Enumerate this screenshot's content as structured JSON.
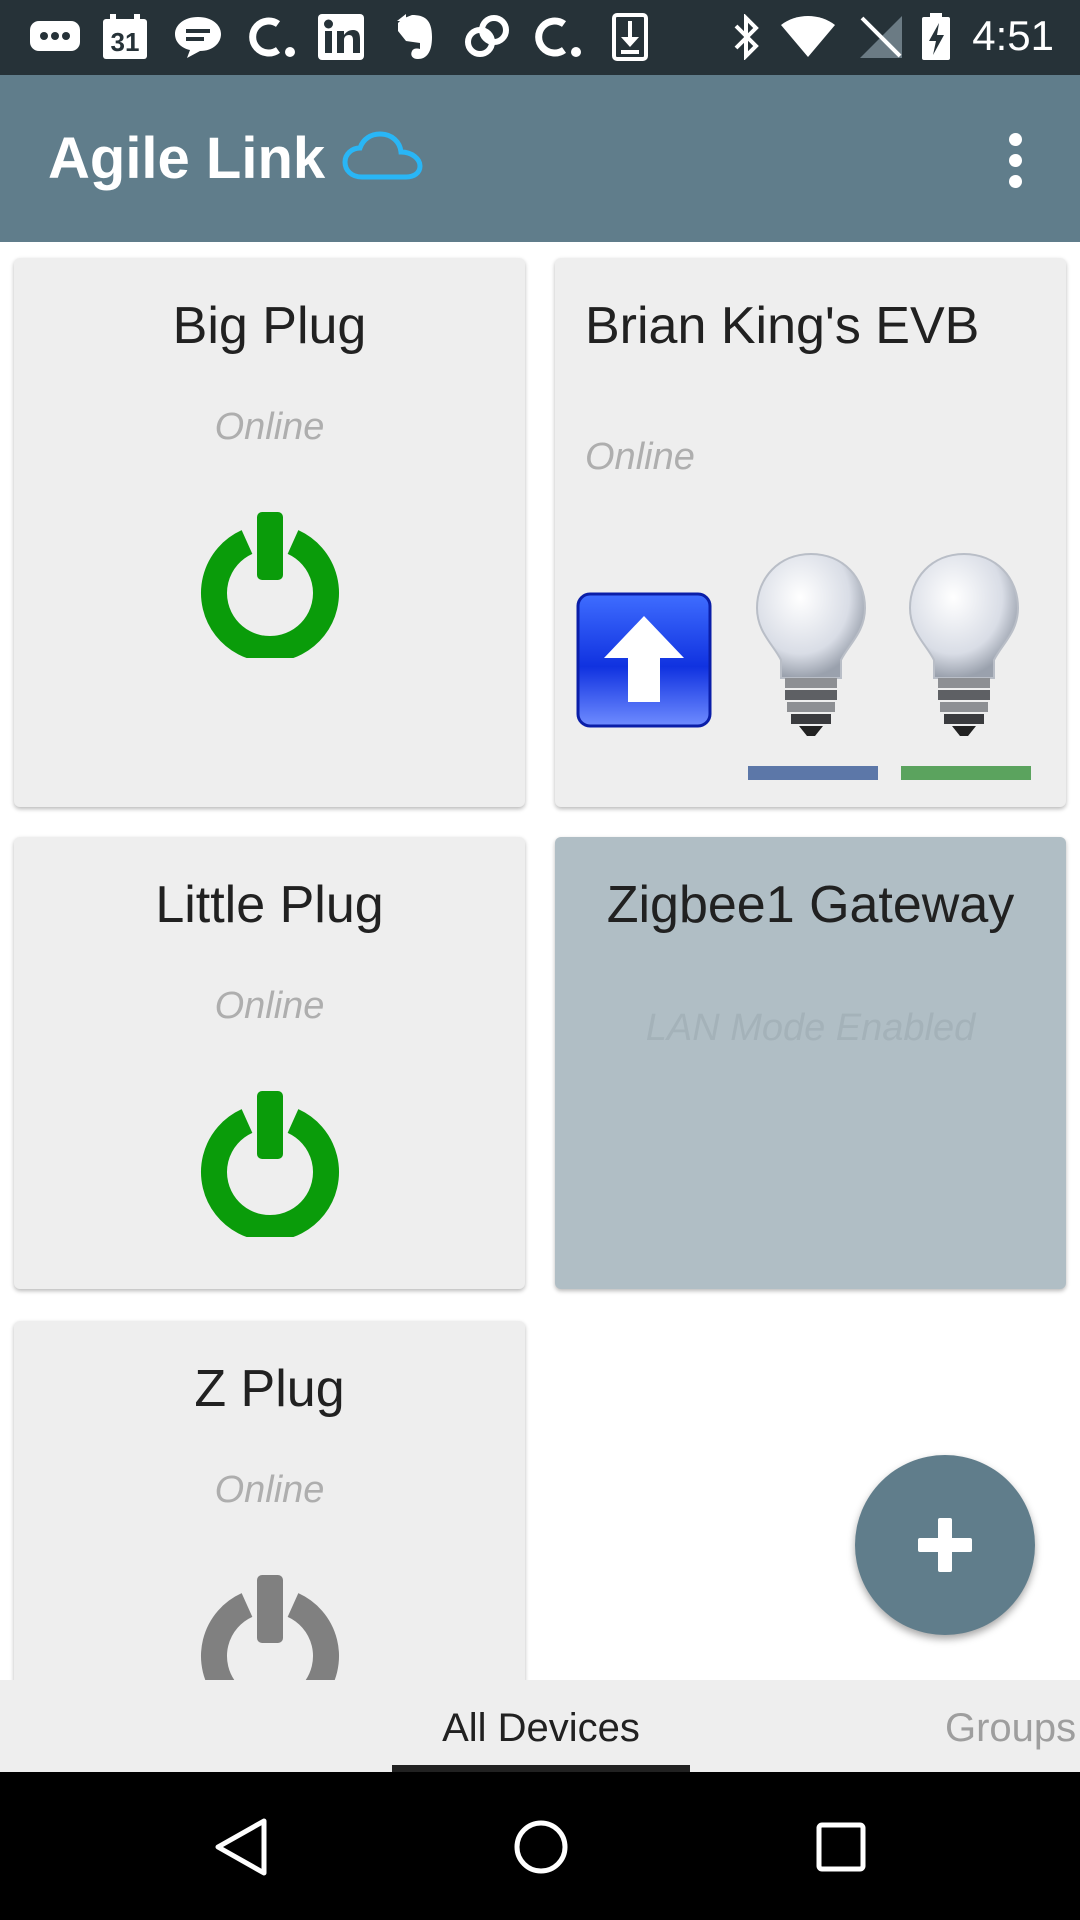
{
  "status_bar": {
    "time": "4:51",
    "calendar_day": "31",
    "notification_icons": [
      "messenger-icon",
      "calendar-icon",
      "chat-icon",
      "c-app-icon",
      "linkedin-icon",
      "evernote-icon",
      "link-icon",
      "c-app-icon",
      "download-icon"
    ],
    "system_icons": [
      "bluetooth-icon",
      "wifi-icon",
      "no-signal-icon",
      "battery-charging-icon"
    ]
  },
  "app_bar": {
    "title": "Agile Link",
    "cloud_icon": "cloud-icon",
    "menu_icon": "more-vert-icon"
  },
  "devices": [
    {
      "name": "Big Plug",
      "status": "Online",
      "icon": "power-icon",
      "power_color": "#0a9c0a"
    },
    {
      "name": "Brian King's EVB",
      "status": "Online",
      "icons": [
        "upload-arrow-icon",
        "light-bulb-icon",
        "light-bulb-icon"
      ],
      "bar_colors": [
        "#5c77a8",
        "#5ba35e"
      ]
    },
    {
      "name": "Little Plug",
      "status": "Online",
      "icon": "power-icon",
      "power_color": "#0a9c0a"
    },
    {
      "name": "Zigbee1 Gateway",
      "status": "LAN Mode Enabled"
    },
    {
      "name": "Z Plug",
      "status": "Online",
      "icon": "power-icon",
      "power_color": "#808080"
    }
  ],
  "fab": {
    "icon": "plus-icon"
  },
  "tabs": [
    {
      "label": "All Devices",
      "selected": true
    },
    {
      "label": "Groups",
      "selected": false
    }
  ],
  "nav_bar": {
    "icons": [
      "back-icon",
      "home-icon",
      "recents-icon"
    ]
  },
  "colors": {
    "app_bar": "#607d8b",
    "status_bar": "#263238",
    "card": "#eeeeee",
    "gateway_card": "#b0bec5",
    "cloud": "#29b6f6"
  }
}
